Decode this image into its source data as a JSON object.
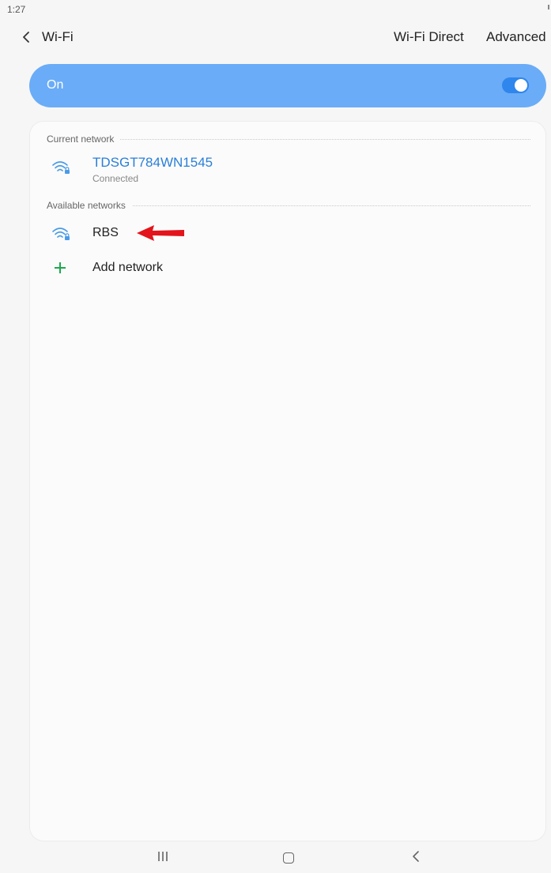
{
  "status_bar": {
    "time": "1:27"
  },
  "app_bar": {
    "back_icon": "chevron-left-icon",
    "title": "Wi-Fi",
    "actions": [
      "Wi-Fi Direct",
      "Advanced"
    ]
  },
  "wifi_toggle": {
    "label": "On",
    "state": true,
    "color": "#6aacf7"
  },
  "current_network": {
    "header": "Current network",
    "name": "TDSGT784WN1545",
    "status": "Connected",
    "icon": "wifi-locked-icon",
    "name_color": "#2a7fd8"
  },
  "available_networks": {
    "header": "Available networks",
    "items": [
      {
        "name": "RBS",
        "icon": "wifi-locked-icon"
      }
    ],
    "add_network": {
      "label": "Add network",
      "icon": "plus-icon",
      "icon_color": "#1fa84f"
    }
  },
  "annotation": {
    "icon": "red-arrow-left-icon",
    "color": "#e3141b"
  },
  "nav_bar": {
    "icons": [
      "recents-icon",
      "home-icon",
      "back-icon"
    ]
  }
}
